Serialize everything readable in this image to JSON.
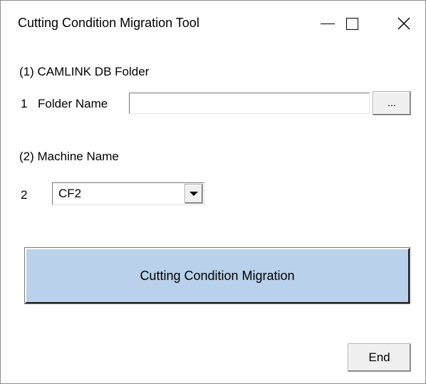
{
  "window": {
    "title": "Cutting Condition Migration Tool"
  },
  "section1": {
    "label": "(1) CAMLINK DB Folder",
    "row_number": "1",
    "field_label": "Folder Name",
    "folder_value": "",
    "browse_label": "..."
  },
  "section2": {
    "label": "(2) Machine Name",
    "row_number": "2",
    "machine_value": "CF2"
  },
  "actions": {
    "migrate_label": "Cutting Condition Migration",
    "end_label": "End"
  },
  "colors": {
    "migrate_button_bg": "#b9d1ea",
    "button_face": "#f0f0f0",
    "window_bg": "#ffffff"
  },
  "icons": {
    "minimize": "minimize-icon",
    "maximize": "maximize-icon",
    "close": "close-icon",
    "dropdown": "chevron-down-icon"
  }
}
